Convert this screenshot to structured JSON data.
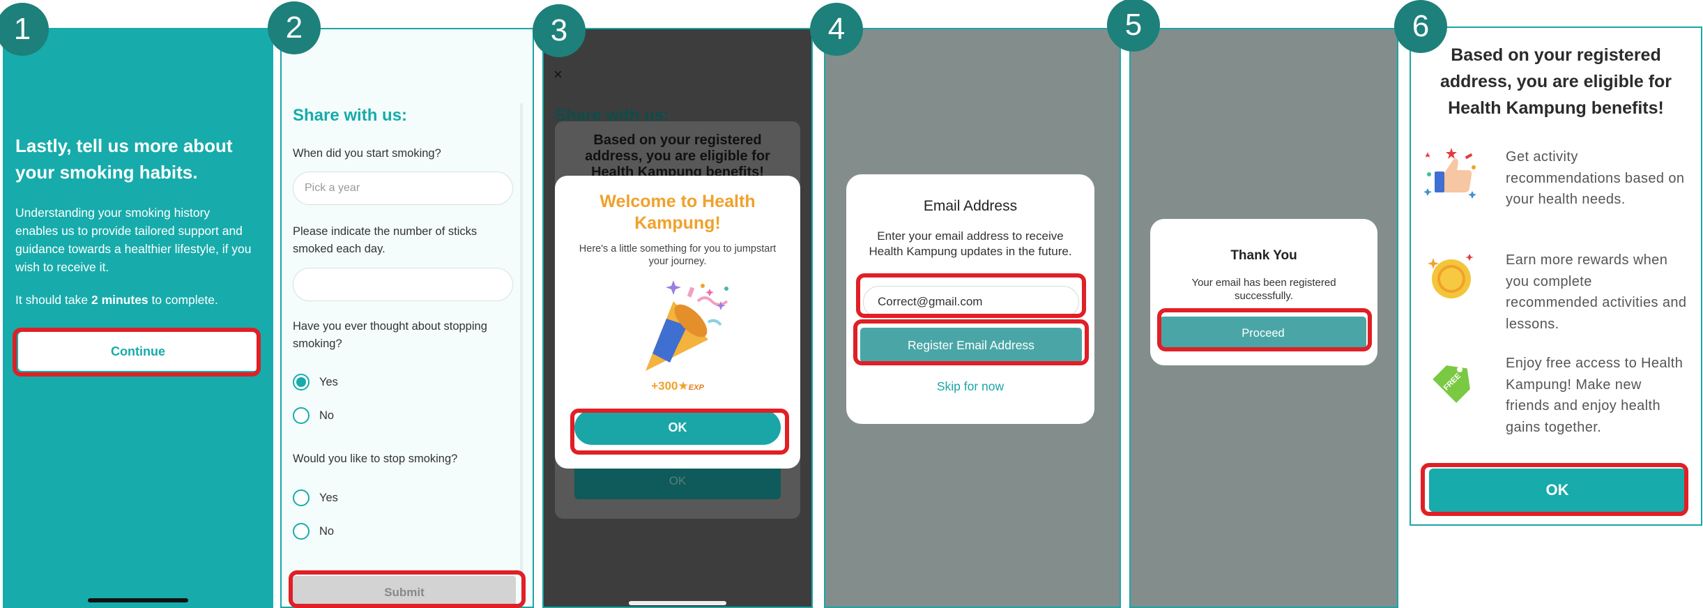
{
  "steps": [
    "1",
    "2",
    "3",
    "4",
    "5",
    "6"
  ],
  "screen1": {
    "title": "Lastly, tell us more about your smoking habits.",
    "body": "Understanding your smoking history enables us to provide tailored support and guidance towards a healthier lifestyle, if you wish to receive it.",
    "duration_prefix": "It should take ",
    "duration_value": "2 minutes",
    "duration_suffix": " to complete.",
    "continue_label": "Continue"
  },
  "screen2": {
    "heading": "Share with us:",
    "q1": "When did you start smoking?",
    "year_placeholder": "Pick a year",
    "q2": "Please indicate the number of sticks smoked each day.",
    "sticks_value": "",
    "q3": "Have you ever thought about stopping smoking?",
    "q3_options": [
      "Yes",
      "No"
    ],
    "q3_selected": "Yes",
    "q4": "Would you like to stop smoking?",
    "q4_options": [
      "Yes",
      "No"
    ],
    "submit_label": "Submit"
  },
  "screen3": {
    "close_icon": "×",
    "behind_heading": "Share with us:",
    "behind_title": "Based on your registered address, you are eligible for Health Kampung benefits!",
    "behind_ok": "OK",
    "modal_title": "Welcome to Health Kampung!",
    "modal_subtitle": "Here's a little something for you to jumpstart your journey.",
    "exp_value": "+300",
    "exp_unit": "EXP",
    "ok_label": "OK"
  },
  "screen4": {
    "title": "Email Address",
    "subtitle": "Enter your email address to receive Health Kampung updates in the future.",
    "email_value": "Correct@gmail.com",
    "register_label": "Register Email Address",
    "skip_label": "Skip for now"
  },
  "screen5": {
    "title": "Thank You",
    "message": "Your email has been registered successfully.",
    "proceed_label": "Proceed"
  },
  "screen6": {
    "title": "Based on your registered address, you are eligible for Health Kampung benefits!",
    "benefits": [
      {
        "icon": "thumbs-up-icon",
        "text": "Get activity recommendations based on your health needs."
      },
      {
        "icon": "coin-icon",
        "text": "Earn more rewards when you complete recommended activities and lessons."
      },
      {
        "icon": "free-tag-icon",
        "text": "Enjoy free access to Health Kampung! Make new friends and enjoy health gains together."
      }
    ],
    "free_tag_text": "FREE",
    "ok_label": "OK"
  },
  "colors": {
    "primary_teal": "#17abab",
    "badge": "#1d807a",
    "highlight": "#e01f26",
    "reward_orange": "#f0a12b"
  }
}
